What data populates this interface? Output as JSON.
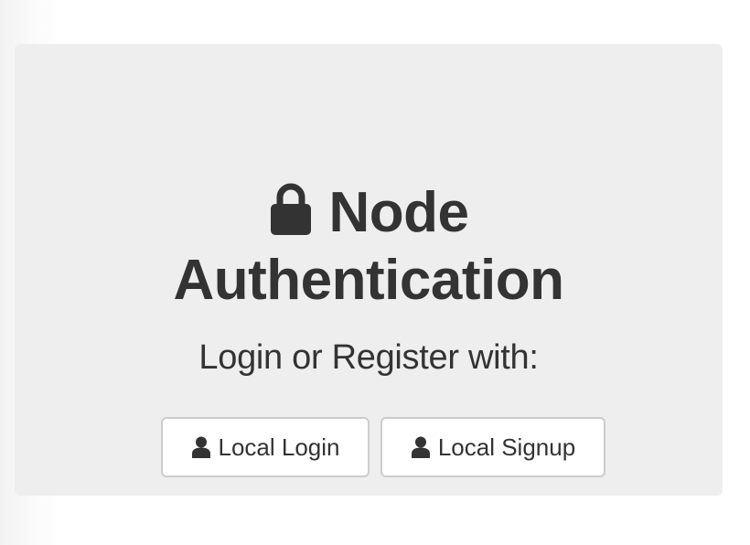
{
  "header": {
    "title_line1": "Node",
    "title_line2": "Authentication",
    "title_icon": "lock-icon",
    "subtitle": "Login or Register with:"
  },
  "buttons": {
    "local_login": {
      "label": "Local Login",
      "icon": "user-icon"
    },
    "local_signup": {
      "label": "Local Signup",
      "icon": "user-icon"
    }
  },
  "colors": {
    "panel_bg": "#eeeeee",
    "text": "#333333",
    "button_bg": "#ffffff",
    "button_border": "#cccccc"
  }
}
